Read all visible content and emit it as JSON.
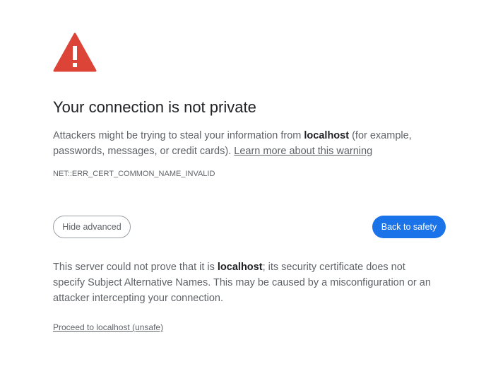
{
  "icon": {
    "name": "warning-triangle-icon",
    "color": "#db4437"
  },
  "heading": {
    "title": "Your connection is not private"
  },
  "main_message": {
    "part1": "Attackers might be trying to steal your information from ",
    "host": "localhost",
    "part2": " (for example, passwords, messages, or credit cards). ",
    "learn_more_link": "Learn more about this warning"
  },
  "error_code": "NET::ERR_CERT_COMMON_NAME_INVALID",
  "buttons": {
    "hide_advanced": "Hide advanced",
    "back_to_safety": "Back to safety",
    "primary_color": "#1a73e8"
  },
  "details": {
    "part1": "This server could not prove that it is ",
    "host": "localhost",
    "part2": "; its security certificate does not specify Subject Alternative Names. This may be caused by a misconfiguration or an attacker intercepting your connection."
  },
  "proceed_link": "Proceed to localhost (unsafe)"
}
